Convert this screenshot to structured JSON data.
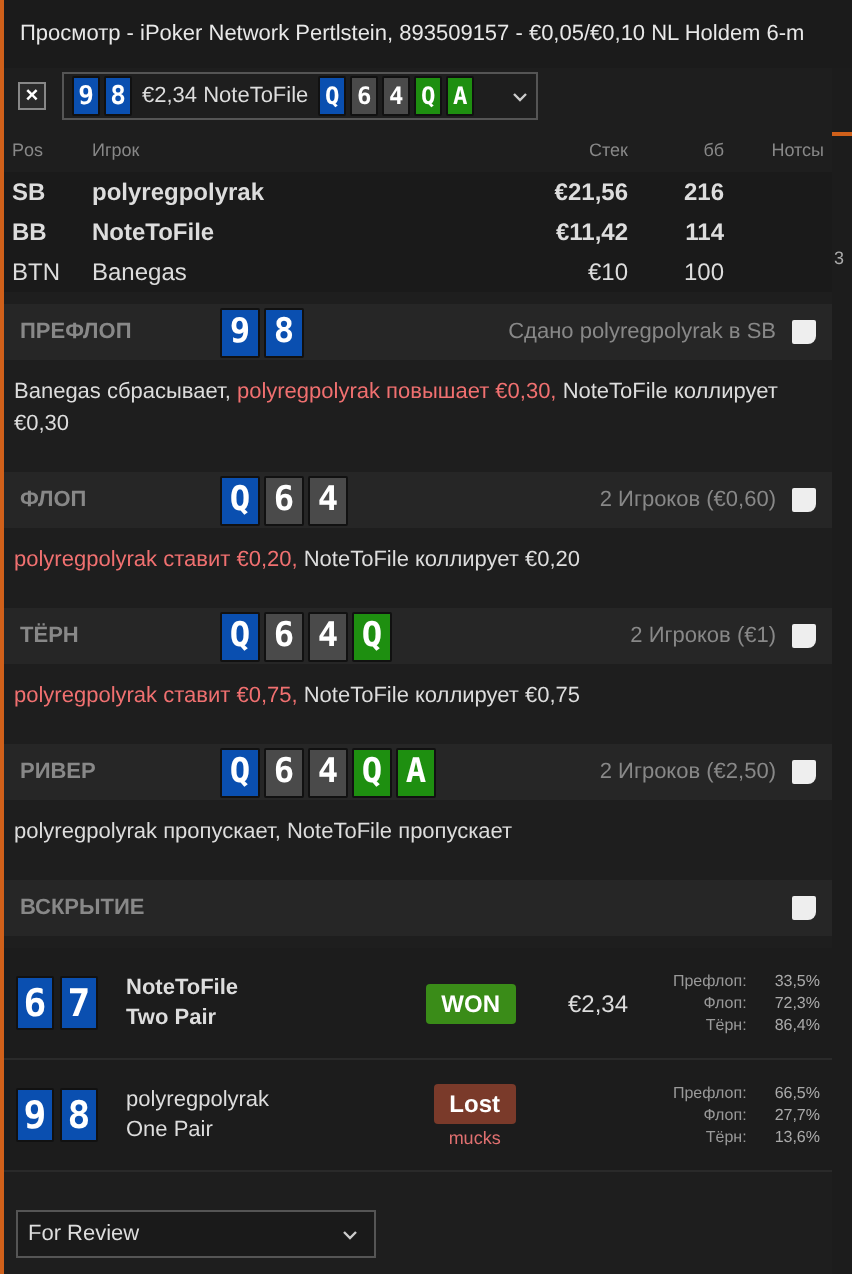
{
  "window": {
    "title": "Просмотр - iPoker Network Pertlstein, 893509157 - €0,05/€0,10 NL Holdem 6-m"
  },
  "hand_selector": {
    "close": "×",
    "hole_cards": [
      {
        "rank": "9",
        "color": "#0a4fb0"
      },
      {
        "rank": "8",
        "color": "#0a4fb0"
      }
    ],
    "summary": "€2,34 NoteToFile",
    "board": [
      {
        "rank": "Q",
        "color": "#0a4fb0"
      },
      {
        "rank": "6",
        "color": "#4a4a4a"
      },
      {
        "rank": "4",
        "color": "#4a4a4a"
      },
      {
        "rank": "Q",
        "color": "#1e8f10"
      },
      {
        "rank": "A",
        "color": "#1e8f10"
      }
    ]
  },
  "players_table": {
    "columns": [
      "Pos",
      "Игрок",
      "Стек",
      "бб",
      "Нотсы"
    ],
    "rows": [
      {
        "pos": "SB",
        "name": "polyregpolyrak",
        "stack": "€21,56",
        "bb": "216",
        "bold": true
      },
      {
        "pos": "BB",
        "name": "NoteToFile",
        "stack": "€11,42",
        "bb": "114",
        "bold": true
      },
      {
        "pos": "BTN",
        "name": "Banegas",
        "stack": "€10",
        "bb": "100",
        "bold": false
      }
    ]
  },
  "side_strip": {
    "text": "3"
  },
  "streets": [
    {
      "name": "ПРЕФЛОП",
      "cards": [
        {
          "rank": "9",
          "color": "#0a4fb0"
        },
        {
          "rank": "8",
          "color": "#0a4fb0"
        }
      ],
      "info": "Сдано polyregpolyrak в SB",
      "checked": false,
      "actions": [
        {
          "text": "Banegas сбрасывает, ",
          "highlight": false
        },
        {
          "text": "polyregpolyrak повышает €0,30, ",
          "highlight": true
        },
        {
          "text": "NoteToFile коллирует €0,30",
          "highlight": false
        }
      ]
    },
    {
      "name": "ФЛОП",
      "cards": [
        {
          "rank": "Q",
          "color": "#0a4fb0"
        },
        {
          "rank": "6",
          "color": "#4a4a4a"
        },
        {
          "rank": "4",
          "color": "#4a4a4a"
        }
      ],
      "info": "2 Игроков (€0,60)",
      "checked": false,
      "actions": [
        {
          "text": "polyregpolyrak ставит €0,20, ",
          "highlight": true
        },
        {
          "text": "NoteToFile коллирует €0,20",
          "highlight": false
        }
      ]
    },
    {
      "name": "ТЁРН",
      "cards": [
        {
          "rank": "Q",
          "color": "#0a4fb0"
        },
        {
          "rank": "6",
          "color": "#4a4a4a"
        },
        {
          "rank": "4",
          "color": "#4a4a4a"
        },
        {
          "rank": "Q",
          "color": "#1e8f10"
        }
      ],
      "info": "2 Игроков (€1)",
      "checked": false,
      "actions": [
        {
          "text": "polyregpolyrak ставит €0,75, ",
          "highlight": true
        },
        {
          "text": "NoteToFile коллирует €0,75",
          "highlight": false
        }
      ]
    },
    {
      "name": "РИВЕР",
      "cards": [
        {
          "rank": "Q",
          "color": "#0a4fb0"
        },
        {
          "rank": "6",
          "color": "#4a4a4a"
        },
        {
          "rank": "4",
          "color": "#4a4a4a"
        },
        {
          "rank": "Q",
          "color": "#1e8f10"
        },
        {
          "rank": "A",
          "color": "#1e8f10"
        }
      ],
      "info": "2 Игроков (€2,50)",
      "checked": false,
      "actions": [
        {
          "text": "polyregpolyrak пропускает, NoteToFile пропускает",
          "highlight": false
        }
      ]
    }
  ],
  "showdown": {
    "name": "ВСКРЫТИЕ",
    "checked": false,
    "players": [
      {
        "cards": [
          {
            "rank": "6",
            "color": "#0a4fb0"
          },
          {
            "rank": "7",
            "color": "#0a4fb0"
          }
        ],
        "name": "NoteToFile",
        "hand": "Two Pair",
        "bold": true,
        "result": "WON",
        "kind": "won",
        "amount": "€2,34",
        "equity": [
          {
            "label": "Префлоп:",
            "value": "33,5%"
          },
          {
            "label": "Флоп:",
            "value": "72,3%"
          },
          {
            "label": "Тёрн:",
            "value": "86,4%"
          }
        ]
      },
      {
        "cards": [
          {
            "rank": "9",
            "color": "#0a4fb0"
          },
          {
            "rank": "8",
            "color": "#0a4fb0"
          }
        ],
        "name": "polyregpolyrak",
        "hand": "One Pair",
        "bold": false,
        "result": "Lost",
        "kind": "lost",
        "note": "mucks",
        "equity": [
          {
            "label": "Префлоп:",
            "value": "66,5%"
          },
          {
            "label": "Флоп:",
            "value": "27,7%"
          },
          {
            "label": "Тёрн:",
            "value": "13,6%"
          }
        ]
      }
    ]
  },
  "footer": {
    "dropdown": "For Review"
  }
}
